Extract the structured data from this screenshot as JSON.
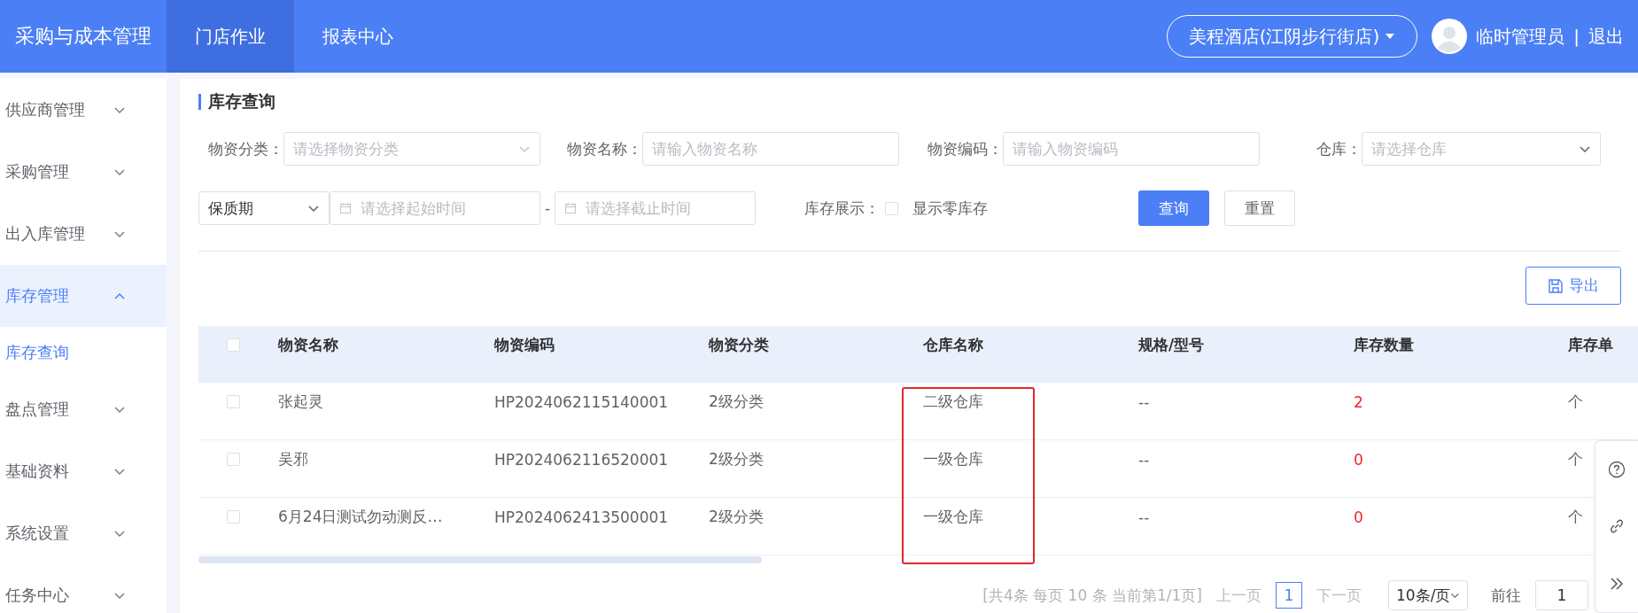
{
  "topbar": {
    "brand": "采购与成本管理",
    "nav": [
      {
        "label": "门店作业",
        "selected": true
      },
      {
        "label": "报表中心",
        "selected": false
      }
    ],
    "store_selector": {
      "value": "美程酒店(江阴步行街店)"
    },
    "user": {
      "name": "临时管理员",
      "separator": "|",
      "logout": "退出"
    }
  },
  "sidebar": {
    "items": [
      {
        "label": "供应商管理",
        "expanded": false,
        "selected": false
      },
      {
        "label": "采购管理",
        "expanded": false,
        "selected": false
      },
      {
        "label": "出入库管理",
        "expanded": false,
        "selected": false
      },
      {
        "label": "库存管理",
        "expanded": true,
        "selected": true,
        "children": [
          {
            "label": "库存查询",
            "selected": true
          }
        ]
      },
      {
        "label": "盘点管理",
        "expanded": false,
        "selected": false
      },
      {
        "label": "基础资料",
        "expanded": false,
        "selected": false
      },
      {
        "label": "系统设置",
        "expanded": false,
        "selected": false
      },
      {
        "label": "任务中心",
        "expanded": false,
        "selected": false
      }
    ]
  },
  "page": {
    "title": "库存查询"
  },
  "filters": [
    {
      "kind": "select",
      "label": "物资分类：",
      "placeholder": "请选择物资分类"
    },
    {
      "kind": "input",
      "label": "物资名称：",
      "placeholder": "请输入物资名称"
    },
    {
      "kind": "input",
      "label": "物资编码：",
      "placeholder": "请输入物资编码"
    },
    {
      "kind": "select",
      "label": "仓库：",
      "placeholder": "请选择仓库"
    }
  ],
  "shelf_life": {
    "value": "保质期"
  },
  "date_range": {
    "start_placeholder": "请选择起始时间",
    "separator": "-",
    "end_placeholder": "请选择截止时间"
  },
  "stock_display": {
    "label": "库存展示：",
    "option": "显示零库存",
    "checked": false
  },
  "buttons": [
    {
      "kind": "primary",
      "label": "查询"
    },
    {
      "kind": "default",
      "label": "重置"
    }
  ],
  "export_button": {
    "label": "导出"
  },
  "table": {
    "select_all": {
      "checked": false
    },
    "columns": [
      {
        "label": "物资名称",
        "kind": "text"
      },
      {
        "label": "物资编码",
        "kind": "text"
      },
      {
        "label": "物资分类",
        "kind": "text"
      },
      {
        "label": "仓库名称",
        "kind": "text"
      },
      {
        "label": "规格/型号",
        "kind": "text"
      },
      {
        "label": "库存数量",
        "kind": "quantity"
      },
      {
        "label": "库存单",
        "kind": "text"
      }
    ],
    "rows": [
      {
        "selected": false,
        "cells": [
          "张起灵",
          "HP2024062115140001",
          "2级分类",
          "二级仓库",
          "--",
          "2",
          "个"
        ]
      },
      {
        "selected": false,
        "cells": [
          "吴邪",
          "HP2024062116520001",
          "2级分类",
          "一级仓库",
          "--",
          "0",
          "个"
        ]
      },
      {
        "selected": false,
        "cells": [
          "6月24日测试勿动测反…",
          "HP2024062413500001",
          "2级分类",
          "一级仓库",
          "--",
          "0",
          "个"
        ]
      }
    ]
  },
  "pagination": {
    "summary": "[共4条 每页 10 条 当前第1/1页]",
    "prev": {
      "label": "上一页",
      "disabled": true
    },
    "pages": [
      {
        "label": "1",
        "selected": true
      }
    ],
    "next": {
      "label": "下一页",
      "disabled": true
    },
    "page_size": "10条/页",
    "goto_label": "前往",
    "goto_value": "1"
  }
}
